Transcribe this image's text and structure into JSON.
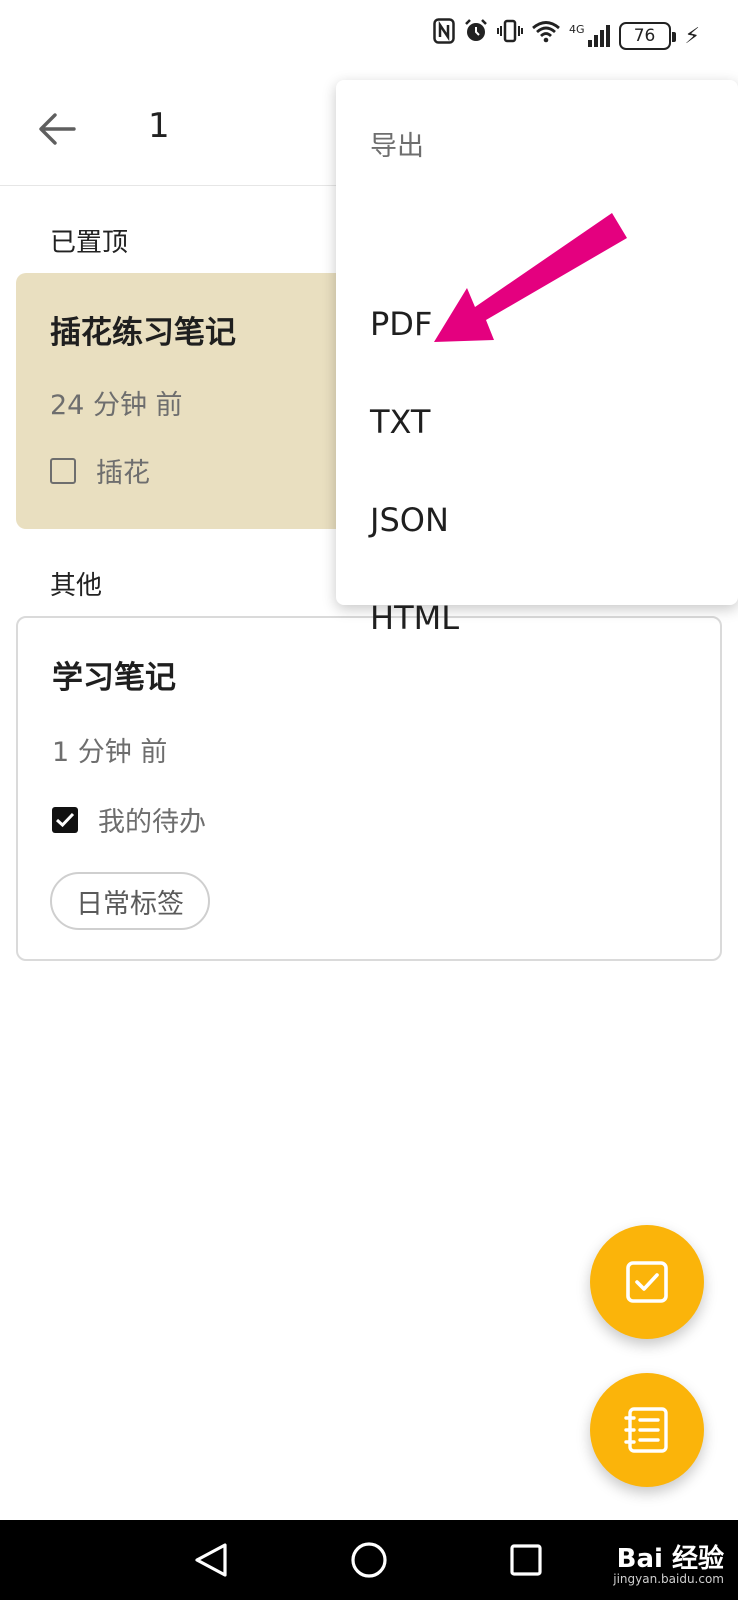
{
  "status_bar": {
    "icons": [
      "nfc-icon",
      "alarm-icon",
      "vibrate-icon",
      "wifi-icon",
      "signal-4g-icon"
    ],
    "network_label": "4G",
    "battery": "76"
  },
  "app_bar": {
    "back_icon": "arrow-left-icon",
    "title": "1"
  },
  "sections": {
    "pinned_label": "已置顶",
    "other_label": "其他"
  },
  "pinned_note": {
    "title": "插花练习笔记",
    "time": "24 分钟 前",
    "todo_label": "插花",
    "todo_checked": false,
    "background": "#e9dfc0"
  },
  "other_note": {
    "title": "学习笔记",
    "time": "1 分钟 前",
    "todo_label": "我的待办",
    "todo_checked": true,
    "tag": "日常标签"
  },
  "export_menu": {
    "header": "导出",
    "items": [
      "PDF",
      "TXT",
      "JSON",
      "HTML"
    ]
  },
  "fabs": {
    "todo_icon": "checkbox-icon",
    "note_icon": "notebook-icon",
    "color": "#fbb40a"
  },
  "annotation": {
    "arrow_color": "#e4007f"
  },
  "nav_bar": {
    "buttons": [
      "back-triangle-icon",
      "home-circle-icon",
      "recents-square-icon"
    ]
  },
  "watermark": {
    "text": "Bai 经验",
    "url": "jingyan.baidu.com"
  }
}
